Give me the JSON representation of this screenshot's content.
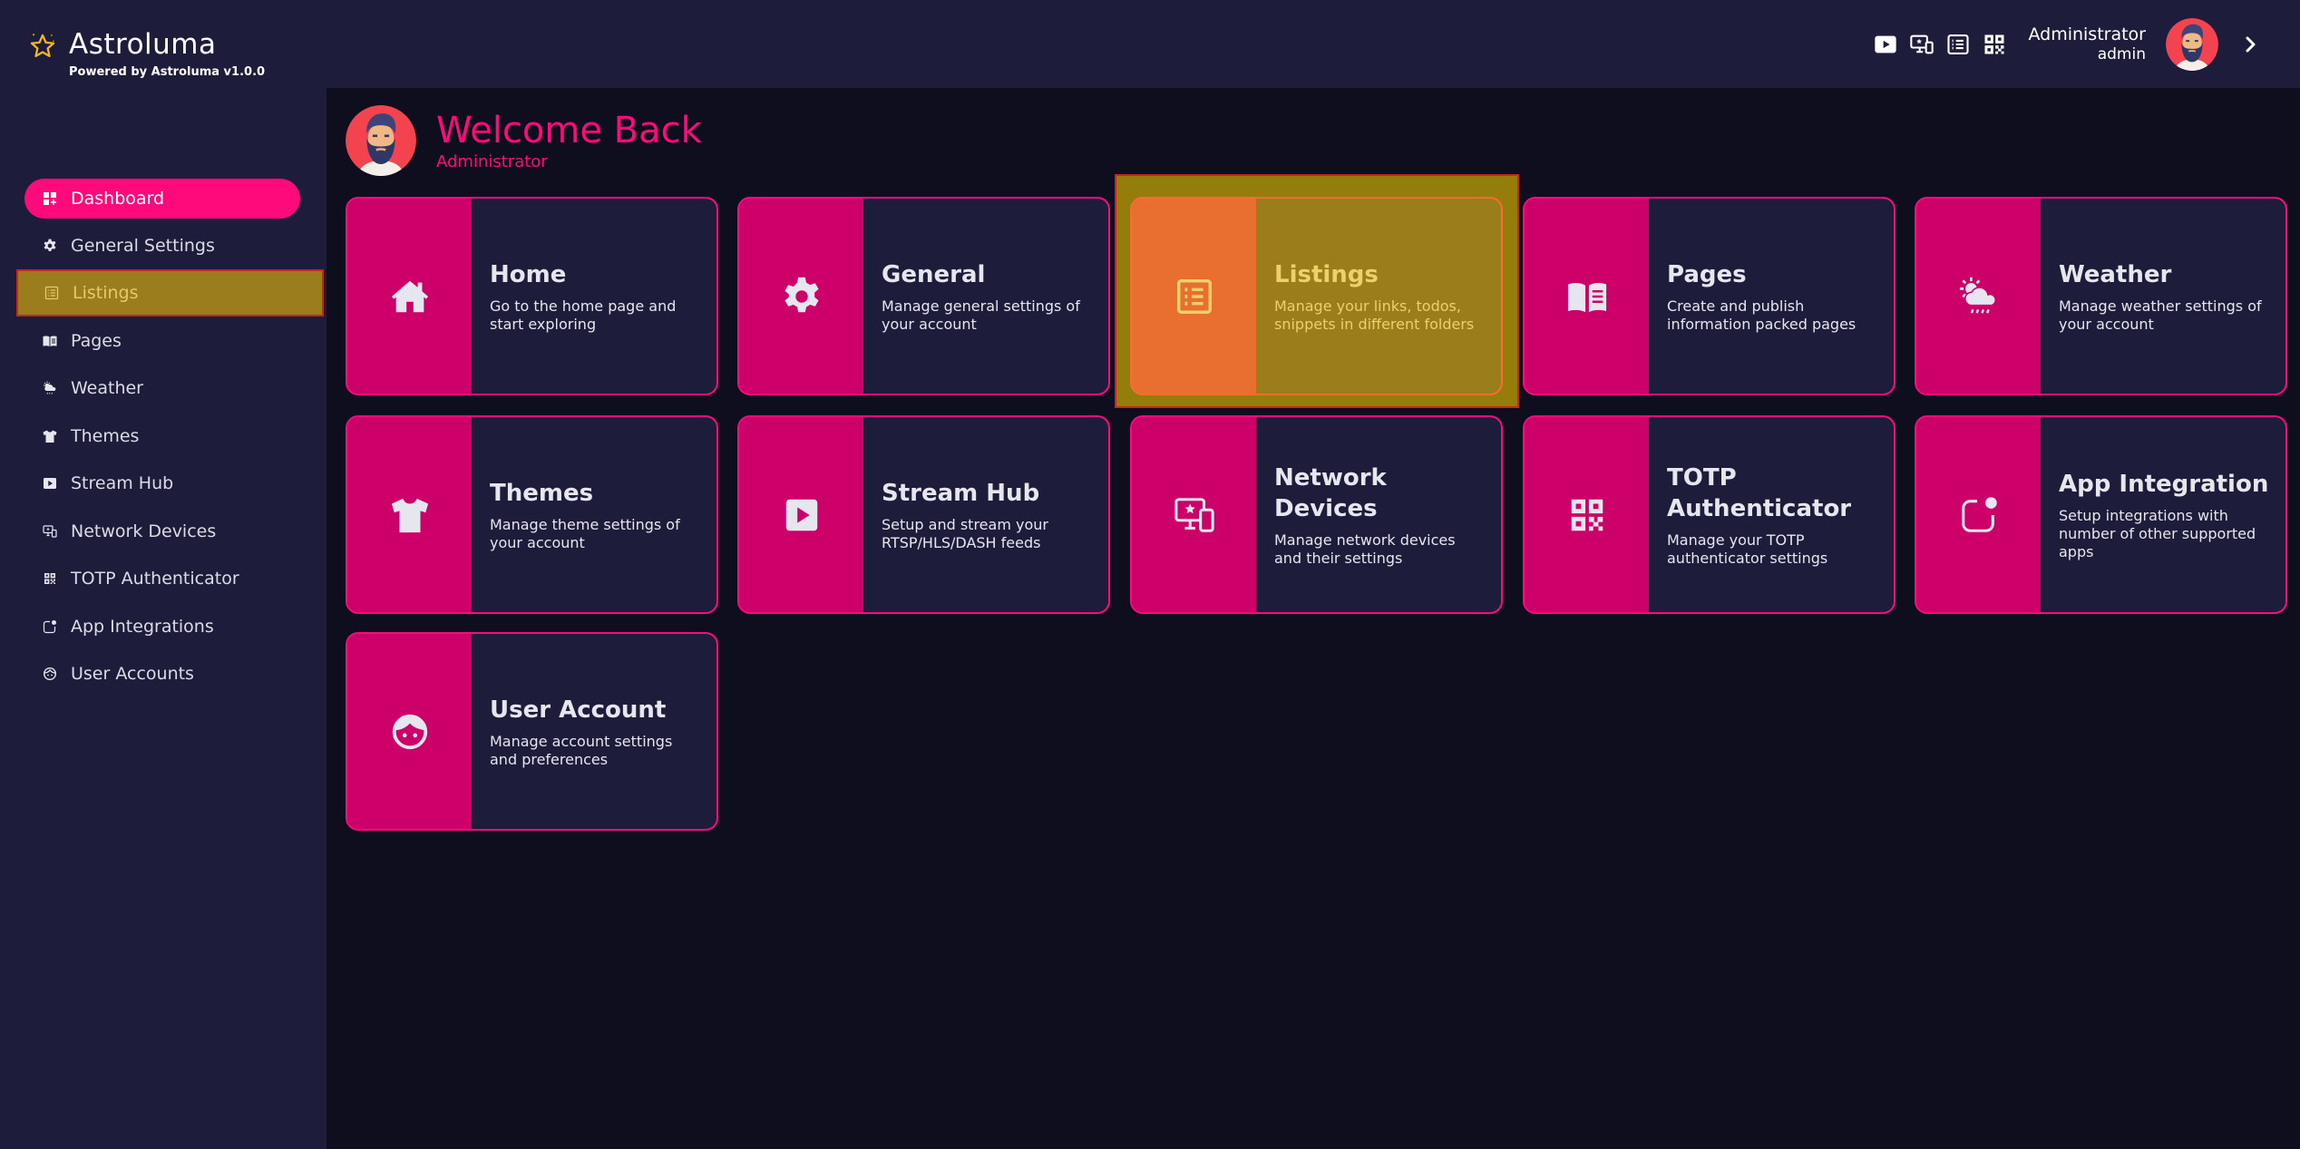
{
  "app": {
    "name": "Astroluma",
    "powered_by": "Powered by Astroluma v1.0.0",
    "brand_icon": "star-icon"
  },
  "header": {
    "quick_icons": [
      {
        "name": "stream-hub-icon"
      },
      {
        "name": "network-devices-icon"
      },
      {
        "name": "listings-icon"
      },
      {
        "name": "totp-qr-icon"
      }
    ],
    "user": {
      "name": "Administrator",
      "role": "admin"
    },
    "expand_icon": "chevron-right-icon"
  },
  "sidebar": {
    "items": [
      {
        "label": "Dashboard",
        "icon": "dashboard-icon",
        "state": "active"
      },
      {
        "label": "General Settings",
        "icon": "gear-icon"
      },
      {
        "label": "Listings",
        "icon": "list-icon",
        "state": "highlighted"
      },
      {
        "label": "Pages",
        "icon": "book-icon"
      },
      {
        "label": "Weather",
        "icon": "weather-icon"
      },
      {
        "label": "Themes",
        "icon": "shirt-icon"
      },
      {
        "label": "Stream Hub",
        "icon": "play-icon"
      },
      {
        "label": "Network Devices",
        "icon": "devices-icon"
      },
      {
        "label": "TOTP Authenticator",
        "icon": "qr-icon"
      },
      {
        "label": "App Integrations",
        "icon": "app-badge-icon"
      },
      {
        "label": "User Accounts",
        "icon": "face-icon"
      }
    ]
  },
  "welcome": {
    "title": "Welcome Back",
    "subtitle": "Administrator"
  },
  "cards": [
    {
      "title": "Home",
      "desc": "Go to the home page and start exploring",
      "icon": "home-icon"
    },
    {
      "title": "General",
      "desc": "Manage general settings of your account",
      "icon": "gear-icon"
    },
    {
      "title": "Listings",
      "desc": "Manage your links, todos, snippets in different folders",
      "icon": "list-icon",
      "state": "highlighted"
    },
    {
      "title": "Pages",
      "desc": "Create and publish information packed pages",
      "icon": "book-icon"
    },
    {
      "title": "Weather",
      "desc": "Manage weather settings of your account",
      "icon": "weather-icon"
    },
    {
      "title": "Themes",
      "desc": "Manage theme settings of your account",
      "icon": "shirt-icon"
    },
    {
      "title": "Stream Hub",
      "desc": "Setup and stream your RTSP/HLS/DASH feeds",
      "icon": "play-icon"
    },
    {
      "title": "Network Devices",
      "desc": "Manage network devices and their settings",
      "icon": "devices-icon"
    },
    {
      "title": "TOTP Authenticator",
      "desc": "Manage your TOTP authenticator settings",
      "icon": "qr-icon"
    },
    {
      "title": "App Integration",
      "desc": "Setup integrations with number of other supported apps",
      "icon": "app-badge-icon"
    },
    {
      "title": "User Account",
      "desc": "Manage account settings and preferences",
      "icon": "face-icon"
    }
  ],
  "colors": {
    "accent": "#ff0a7a",
    "card_icon_bg": "#cc0068",
    "panel_bg": "#1d1c3b",
    "page_bg": "#0f0e1e",
    "highlight": "#9b7d1d"
  }
}
